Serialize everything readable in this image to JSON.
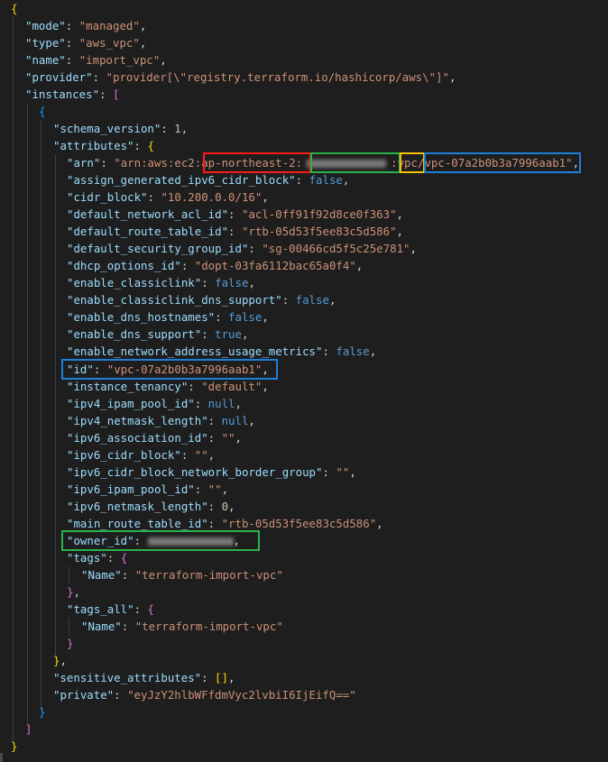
{
  "editor": {
    "open_brace": "{",
    "close_brace": "}",
    "mode_key": "\"mode\"",
    "mode_val": "\"managed\"",
    "type_key": "\"type\"",
    "type_val": "\"aws_vpc\"",
    "name_key": "\"name\"",
    "name_val": "\"import_vpc\"",
    "provider_key": "\"provider\"",
    "provider_val": "\"provider[\\\"registry.terraform.io/hashicorp/aws\\\"]\"",
    "instances_key": "\"instances\"",
    "open_bracket": "[",
    "close_bracket": "]",
    "schema_version_key": "\"schema_version\"",
    "schema_version_val": "1",
    "attributes_key": "\"attributes\"",
    "arn_key": "\"arn\"",
    "arn_prefix": "\"arn:aws:ec2:",
    "arn_region": "ap-northeast-2",
    "arn_vpc": "vpc",
    "arn_vpc_id": "vpc-07a2b0b3a7996aab1\"",
    "attrs": [
      {
        "key": "\"assign_generated_ipv6_cidr_block\"",
        "val": "false",
        "kind": "b"
      },
      {
        "key": "\"cidr_block\"",
        "val": "\"10.200.0.0/16\"",
        "kind": "s"
      },
      {
        "key": "\"default_network_acl_id\"",
        "val": "\"acl-0ff91f92d8ce0f363\"",
        "kind": "s"
      },
      {
        "key": "\"default_route_table_id\"",
        "val": "\"rtb-05d53f5ee83c5d586\"",
        "kind": "s"
      },
      {
        "key": "\"default_security_group_id\"",
        "val": "\"sg-00466cd5f5c25e781\"",
        "kind": "s"
      },
      {
        "key": "\"dhcp_options_id\"",
        "val": "\"dopt-03fa6112bac65a0f4\"",
        "kind": "s"
      },
      {
        "key": "\"enable_classiclink\"",
        "val": "false",
        "kind": "b"
      },
      {
        "key": "\"enable_classiclink_dns_support\"",
        "val": "false",
        "kind": "b"
      },
      {
        "key": "\"enable_dns_hostnames\"",
        "val": "false",
        "kind": "b"
      },
      {
        "key": "\"enable_dns_support\"",
        "val": "true",
        "kind": "b"
      },
      {
        "key": "\"enable_network_address_usage_metrics\"",
        "val": "false",
        "kind": "b"
      }
    ],
    "id_key": "\"id\"",
    "id_val": "\"vpc-07a2b0b3a7996aab1\"",
    "attrs2": [
      {
        "key": "\"instance_tenancy\"",
        "val": "\"default\"",
        "kind": "s"
      },
      {
        "key": "\"ipv4_ipam_pool_id\"",
        "val": "null",
        "kind": "b"
      },
      {
        "key": "\"ipv4_netmask_length\"",
        "val": "null",
        "kind": "b"
      },
      {
        "key": "\"ipv6_association_id\"",
        "val": "\"\"",
        "kind": "s"
      },
      {
        "key": "\"ipv6_cidr_block\"",
        "val": "\"\"",
        "kind": "s"
      },
      {
        "key": "\"ipv6_cidr_block_network_border_group\"",
        "val": "\"\"",
        "kind": "s"
      },
      {
        "key": "\"ipv6_ipam_pool_id\"",
        "val": "\"\"",
        "kind": "s"
      },
      {
        "key": "\"ipv6_netmask_length\"",
        "val": "0",
        "kind": "n"
      },
      {
        "key": "\"main_route_table_id\"",
        "val": "\"rtb-05d53f5ee83c5d586\"",
        "kind": "s"
      }
    ],
    "owner_id_key": "\"owner_id\"",
    "tags_key": "\"tags\"",
    "tags_all_key": "\"tags_all\"",
    "tag_name_key": "\"Name\"",
    "tag_name_val": "\"terraform-import-vpc\"",
    "sensitive_key": "\"sensitive_attributes\"",
    "sensitive_val": "[]",
    "private_key": "\"private\"",
    "private_val": "\"eyJzY2hlbWFfdmVyc2lvbiI6IjEifQ==\""
  }
}
